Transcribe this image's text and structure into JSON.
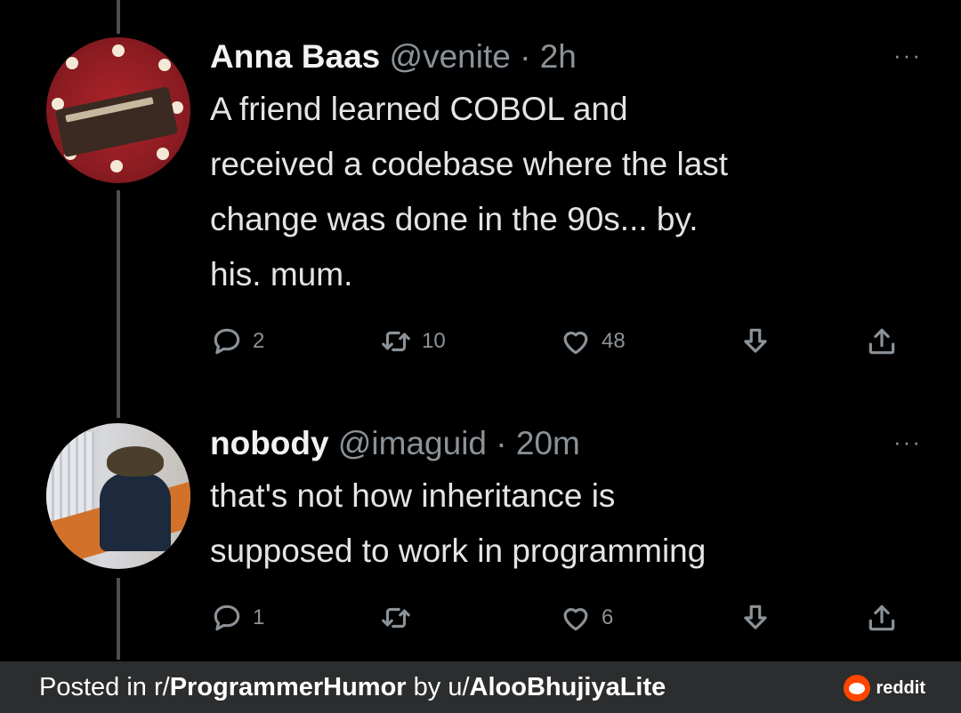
{
  "tweets": [
    {
      "name": "Anna Baas",
      "handle": "@venite",
      "separator": "·",
      "time": "2h",
      "more": "···",
      "text_lines": [
        "A friend learned COBOL and",
        "received a codebase where the last",
        "change was done in the 90s... by.",
        "his. mum."
      ],
      "replies": "2",
      "retweets": "10",
      "likes": "48"
    },
    {
      "name": "nobody",
      "handle": "@imaguid",
      "separator": "·",
      "time": "20m",
      "more": "···",
      "text_lines": [
        "that's not how inheritance is",
        "supposed to work in programming"
      ],
      "replies": "1",
      "retweets": "",
      "likes": "6"
    }
  ],
  "icons": {
    "reply": "reply-icon",
    "retweet": "retweet-icon",
    "like": "heart-icon",
    "bookmark": "bookmark-arrow-icon",
    "share": "share-icon"
  },
  "footer": {
    "prefix": "Posted in r/",
    "subreddit": "ProgrammerHumor",
    "middle": " by u/",
    "user": "AlooBhujiyaLite",
    "brand": "reddit",
    "brand_color": "#ff4500"
  }
}
